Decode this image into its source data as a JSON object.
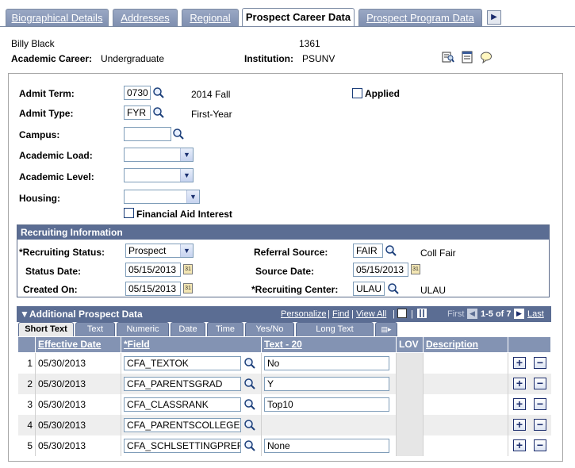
{
  "tabs": [
    {
      "label": "Biographical Details",
      "state": "inactive"
    },
    {
      "label": "Addresses",
      "state": "inactive"
    },
    {
      "label": "Regional",
      "state": "inactive"
    },
    {
      "label": "Prospect Career Data",
      "state": "active"
    },
    {
      "label": "Prospect Program Data",
      "state": "inactive"
    }
  ],
  "header": {
    "name": "Billy Black",
    "id": "1361",
    "career_label": "Academic Career:",
    "career_value": "Undergraduate",
    "institution_label": "Institution:",
    "institution_value": "PSUNV"
  },
  "form": {
    "admit_term_label": "Admit Term:",
    "admit_term_value": "0730",
    "admit_term_desc": "2014 Fall",
    "applied_label": "Applied",
    "admit_type_label": "Admit Type:",
    "admit_type_value": "FYR",
    "admit_type_desc": "First-Year",
    "campus_label": "Campus:",
    "campus_value": "",
    "academic_load_label": "Academic Load:",
    "academic_load_value": "",
    "academic_level_label": "Academic Level:",
    "academic_level_value": "",
    "housing_label": "Housing:",
    "housing_value": "",
    "fin_aid_label": "Financial Aid Interest"
  },
  "recruiting": {
    "title": "Recruiting Information",
    "status_label": "*Recruiting Status:",
    "status_value": "Prospect",
    "referral_label": "Referral Source:",
    "referral_value": "FAIR",
    "referral_desc": "Coll Fair",
    "status_date_label": "Status Date:",
    "status_date_value": "05/15/2013",
    "source_date_label": "Source Date:",
    "source_date_value": "05/15/2013",
    "created_label": "Created On:",
    "created_value": "05/15/2013",
    "center_label": "*Recruiting Center:",
    "center_value": "ULAU",
    "center_desc": "ULAU"
  },
  "grid": {
    "title": "Additional Prospect Data",
    "personalize": "Personalize",
    "find": "Find",
    "view_all": "View All",
    "first": "First",
    "range": "1-5 of 7",
    "last": "Last",
    "subtabs": [
      "Short Text",
      "Text",
      "Numeric",
      "Date",
      "Time",
      "Yes/No",
      "Long Text"
    ],
    "columns": [
      "Effective Date",
      "*Field",
      "Text - 20",
      "LOV",
      "Description"
    ],
    "rows": [
      {
        "num": "1",
        "date": "05/30/2013",
        "field": "CFA_TEXTOK",
        "text": "No"
      },
      {
        "num": "2",
        "date": "05/30/2013",
        "field": "CFA_PARENTSGRAD",
        "text": "Y"
      },
      {
        "num": "3",
        "date": "05/30/2013",
        "field": "CFA_CLASSRANK",
        "text": "Top10"
      },
      {
        "num": "4",
        "date": "05/30/2013",
        "field": "CFA_PARENTSCOLLEGE",
        "text": ""
      },
      {
        "num": "5",
        "date": "05/30/2013",
        "field": "CFA_SCHLSETTINGPREF",
        "text": "None"
      }
    ]
  }
}
